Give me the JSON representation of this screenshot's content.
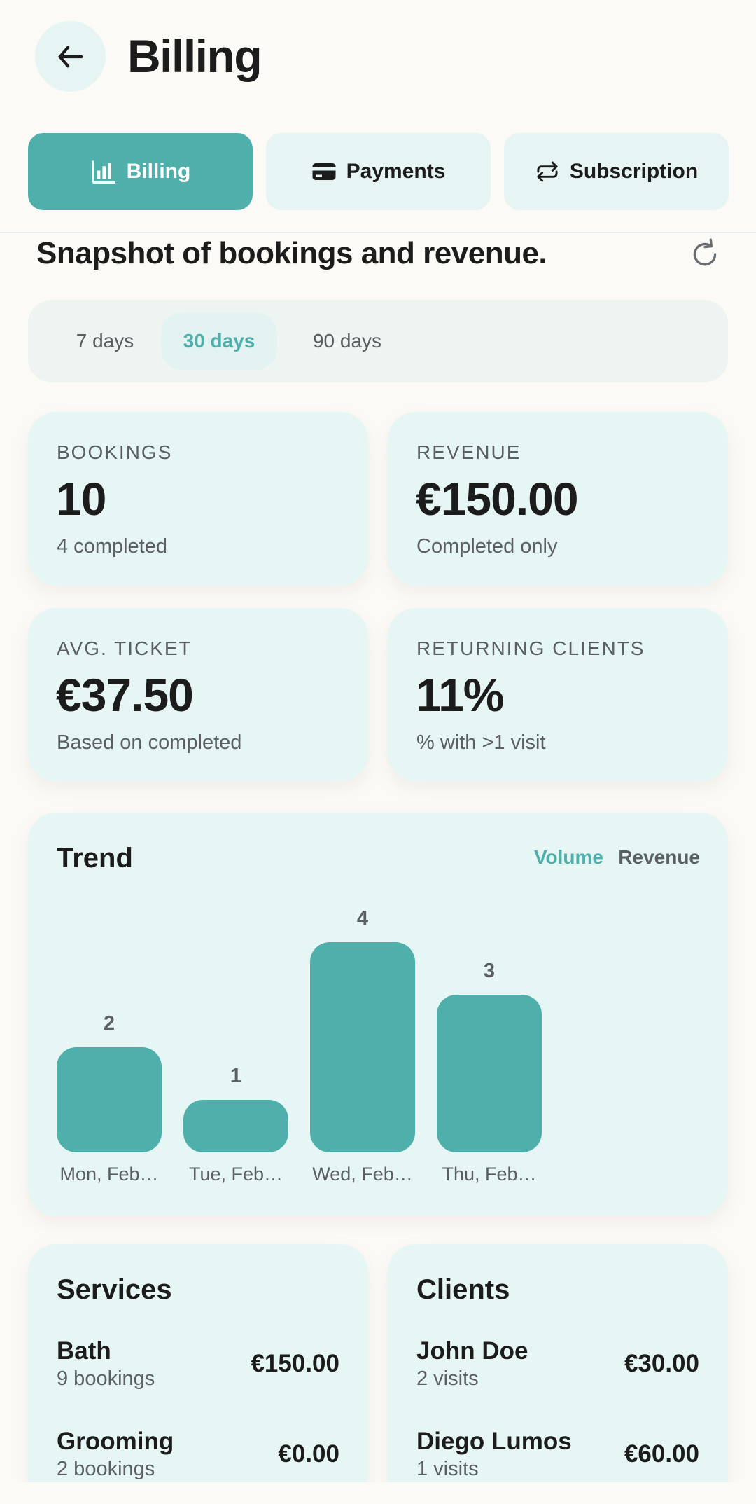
{
  "header": {
    "title": "Billing"
  },
  "tabs": [
    {
      "label": "Billing",
      "icon": "bar-chart-icon",
      "active": true
    },
    {
      "label": "Payments",
      "icon": "card-icon",
      "active": false
    },
    {
      "label": "Subscription",
      "icon": "repeat-icon",
      "active": false
    }
  ],
  "snapshot": {
    "title": "Snapshot of bookings and revenue."
  },
  "ranges": [
    {
      "label": "7 days",
      "active": false
    },
    {
      "label": "30 days",
      "active": true
    },
    {
      "label": "90 days",
      "active": false
    }
  ],
  "stats": [
    {
      "label": "BOOKINGS",
      "value": "10",
      "sub": "4 completed"
    },
    {
      "label": "REVENUE",
      "value": "€150.00",
      "sub": "Completed only"
    },
    {
      "label": "AVG. TICKET",
      "value": "€37.50",
      "sub": "Based on completed"
    },
    {
      "label": "RETURNING CLIENTS",
      "value": "11%",
      "sub": "% with >1 visit"
    }
  ],
  "trend": {
    "title": "Trend",
    "toggle": {
      "volume": "Volume",
      "revenue": "Revenue",
      "active": "Volume"
    }
  },
  "chart_data": {
    "type": "bar",
    "categories": [
      "Mon, Feb…",
      "Tue, Feb…",
      "Wed, Feb…",
      "Thu, Feb…"
    ],
    "values": [
      2,
      1,
      4,
      3
    ],
    "title": "Trend",
    "xlabel": "",
    "ylabel": "",
    "ylim": [
      0,
      4
    ],
    "grid": false,
    "color": "#4fb0ab"
  },
  "services": {
    "title": "Services",
    "items": [
      {
        "name": "Bath",
        "meta": "9 bookings",
        "amount": "€150.00"
      },
      {
        "name": "Grooming",
        "meta": "2 bookings",
        "amount": "€0.00"
      }
    ]
  },
  "clients": {
    "title": "Clients",
    "items": [
      {
        "name": "John Doe",
        "meta": "2 visits",
        "amount": "€30.00"
      },
      {
        "name": "Diego Lumos",
        "meta": "1 visits",
        "amount": "€60.00"
      }
    ]
  },
  "colors": {
    "accent": "#4fb0ab",
    "card": "#e6f6f5",
    "background": "#fbfaf7"
  }
}
